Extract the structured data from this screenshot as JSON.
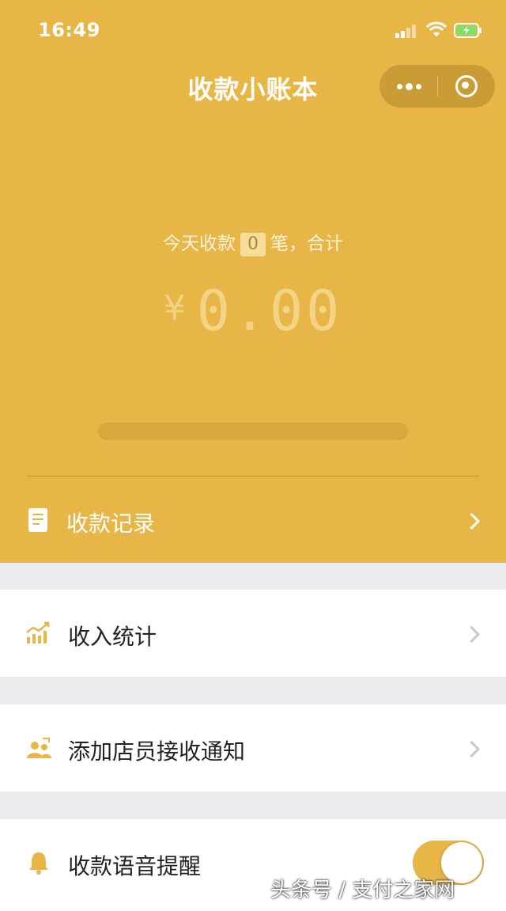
{
  "status_bar": {
    "time": "16:49"
  },
  "nav": {
    "title": "收款小账本",
    "menu_icon": "more-dots-icon",
    "close_icon": "target-circle-icon"
  },
  "summary": {
    "prefix": "今天收款",
    "count": "0",
    "suffix": "笔，合计",
    "currency": "¥",
    "amount": "0.00"
  },
  "menu": {
    "records": {
      "label": "收款记录",
      "icon": "document-icon"
    },
    "income_stats": {
      "label": "收入统计",
      "icon": "bar-chart-icon"
    },
    "add_staff": {
      "label": "添加店员接收通知",
      "icon": "staff-icon"
    },
    "voice_alert": {
      "label": "收款语音提醒",
      "icon": "bell-icon",
      "enabled": true
    }
  },
  "watermark": "头条号 / 支付之家网",
  "colors": {
    "accent": "#e7b647",
    "background": "#ececf0"
  }
}
